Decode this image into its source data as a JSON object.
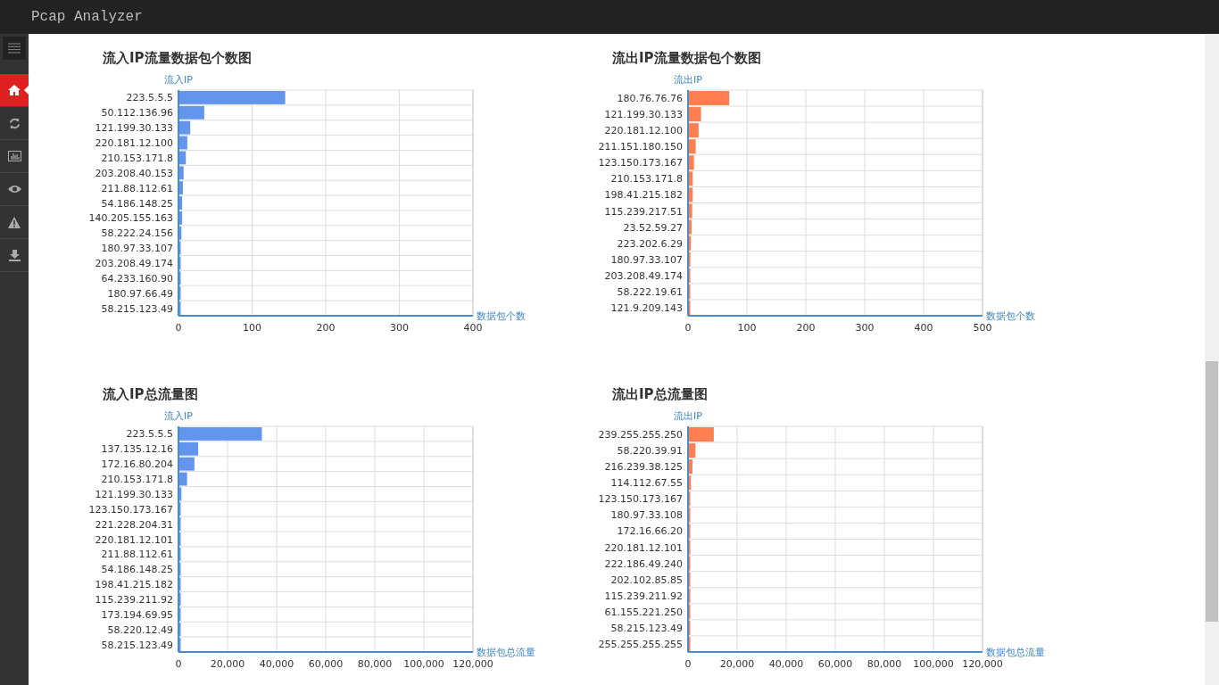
{
  "app": {
    "title": "Pcap Analyzer"
  },
  "sidebar": {
    "items": [
      {
        "kind": "home",
        "selected": true
      },
      {
        "kind": "refresh",
        "selected": false
      },
      {
        "kind": "chart",
        "selected": false
      },
      {
        "kind": "eye",
        "selected": false
      },
      {
        "kind": "warning",
        "selected": false
      },
      {
        "kind": "download",
        "selected": false
      }
    ]
  },
  "panels": [
    {
      "title": "流入IP流量数据包个数图",
      "chart_data": {
        "type": "bar",
        "orientation": "horizontal",
        "xlabel": "数据包个数",
        "ylabel": "流入IP",
        "categories": [
          "223.5.5.5",
          "50.112.136.96",
          "121.199.30.133",
          "220.181.12.100",
          "210.153.171.8",
          "203.208.40.153",
          "211.88.112.61",
          "54.186.148.25",
          "140.205.155.163",
          "58.222.24.156",
          "180.97.33.107",
          "203.208.49.174",
          "64.233.160.90",
          "180.97.66.49",
          "58.215.123.49"
        ],
        "series": [
          {
            "color": "#6495ed",
            "values": [
              145,
              35,
              16,
              12,
              10,
              7,
              6,
              5,
              5,
              4,
              3,
              2,
              1,
              1,
              1
            ]
          }
        ],
        "grid": true,
        "xlim": [
          0,
          400
        ],
        "xticks": [
          0,
          100,
          200,
          300,
          400
        ]
      }
    },
    {
      "title": "流出IP流量数据包个数图",
      "chart_data": {
        "type": "bar",
        "orientation": "horizontal",
        "xlabel": "数据包个数",
        "ylabel": "流出IP",
        "categories": [
          "180.76.76.76",
          "121.199.30.133",
          "220.181.12.100",
          "211.151.180.150",
          "123.150.173.167",
          "210.153.171.8",
          "198.41.215.182",
          "115.239.217.51",
          "23.52.59.27",
          "223.202.6.29",
          "180.97.33.107",
          "203.208.49.174",
          "58.222.19.61",
          "121.9.209.143"
        ],
        "series": [
          {
            "color": "#ff7f50",
            "values": [
              70,
              22,
              18,
              13,
              10,
              8,
              8,
              7,
              6,
              5,
              4,
              3,
              2,
              1
            ]
          }
        ],
        "grid": true,
        "xlim": [
          0,
          500
        ],
        "xticks": [
          0,
          100,
          200,
          300,
          400,
          500
        ]
      }
    },
    {
      "title": "流入IP总流量图",
      "chart_data": {
        "type": "bar",
        "orientation": "horizontal",
        "xlabel": "数据包总流量",
        "ylabel": "流入IP",
        "categories": [
          "223.5.5.5",
          "137.135.12.16",
          "172.16.80.204",
          "210.153.171.8",
          "121.199.30.133",
          "123.150.173.167",
          "221.228.204.31",
          "220.181.12.101",
          "211.88.112.61",
          "54.186.148.25",
          "198.41.215.182",
          "115.239.211.92",
          "173.194.69.95",
          "58.220.12.49",
          "58.215.123.49"
        ],
        "series": [
          {
            "color": "#6495ed",
            "values": [
              34000,
              8000,
              6500,
              3500,
              1200,
              900,
              600,
              500,
              400,
              300,
              200,
              200,
              100,
              100,
              100
            ]
          }
        ],
        "grid": true,
        "xlim": [
          0,
          120000
        ],
        "xticks": [
          {
            "value": 0,
            "label": "0"
          },
          {
            "value": 20000,
            "label": "20,000"
          },
          {
            "value": 40000,
            "label": "40,000"
          },
          {
            "value": 60000,
            "label": "60,000"
          },
          {
            "value": 80000,
            "label": "80,000"
          },
          {
            "value": 100000,
            "label": "100,000"
          },
          {
            "value": 120000,
            "label": "120,000"
          }
        ]
      }
    },
    {
      "title": "流出IP总流量图",
      "chart_data": {
        "type": "bar",
        "orientation": "horizontal",
        "xlabel": "数据包总流量",
        "ylabel": "流出IP",
        "categories": [
          "239.255.255.250",
          "58.220.39.91",
          "216.239.38.125",
          "114.112.67.55",
          "123.150.173.167",
          "180.97.33.108",
          "172.16.66.20",
          "220.181.12.101",
          "222.186.49.240",
          "202.102.85.85",
          "115.239.211.92",
          "61.155.221.250",
          "58.215.123.49",
          "255.255.255.255"
        ],
        "series": [
          {
            "color": "#ff7f50",
            "values": [
              10500,
              3000,
              1800,
              1200,
              800,
              500,
              400,
              300,
              300,
              200,
              200,
              100,
              100,
              100
            ]
          }
        ],
        "grid": true,
        "xlim": [
          0,
          120000
        ],
        "xticks": [
          {
            "value": 0,
            "label": "0"
          },
          {
            "value": 20000,
            "label": "20,000"
          },
          {
            "value": 40000,
            "label": "40,000"
          },
          {
            "value": 60000,
            "label": "60,000"
          },
          {
            "value": 80000,
            "label": "80,000"
          },
          {
            "value": 100000,
            "label": "100,000"
          },
          {
            "value": 120000,
            "label": "120,000"
          }
        ]
      }
    }
  ]
}
